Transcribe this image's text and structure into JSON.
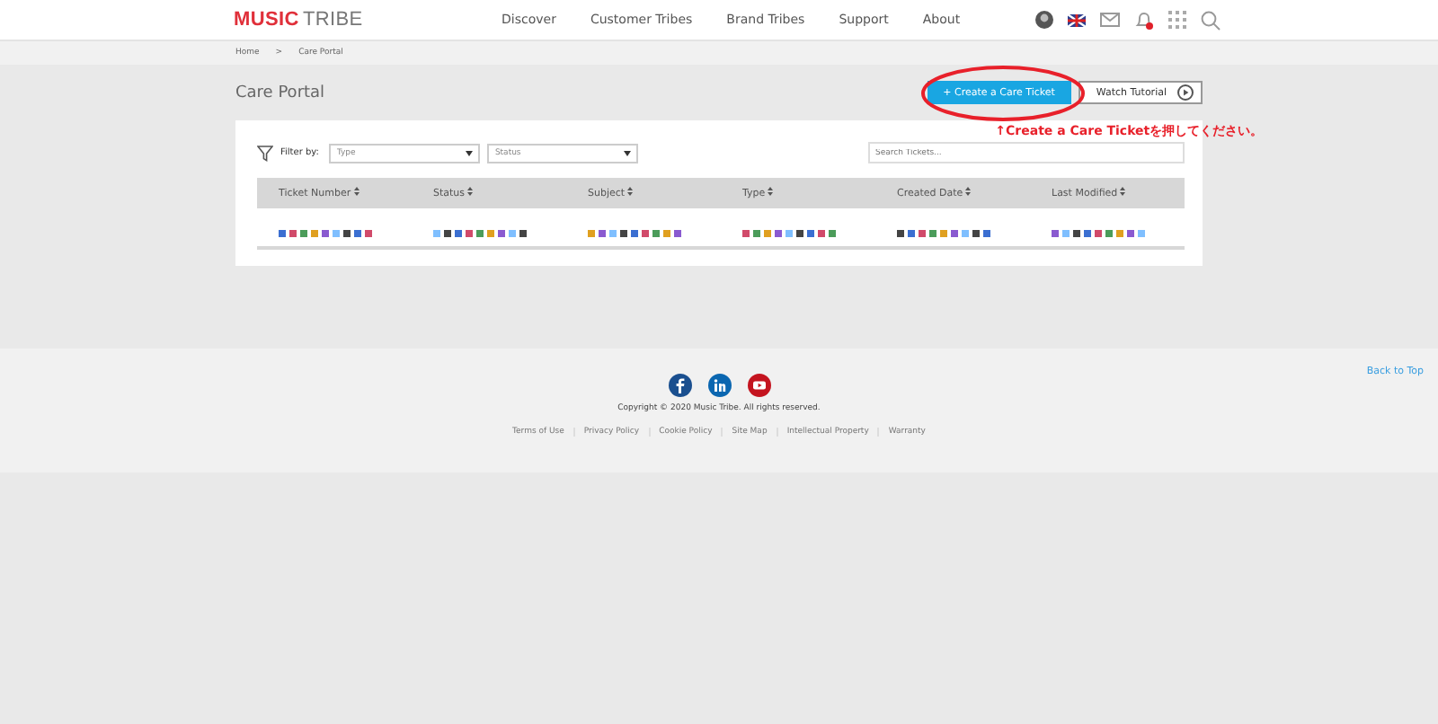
{
  "header": {
    "logo_bold": "MUSIC",
    "logo_light": "TRIBE",
    "nav": [
      {
        "label": "Discover"
      },
      {
        "label": "Customer Tribes"
      },
      {
        "label": "Brand Tribes"
      },
      {
        "label": "Support"
      },
      {
        "label": "About"
      }
    ],
    "notification_dot": true
  },
  "breadcrumb": [
    "Home",
    ">",
    "Care Portal"
  ],
  "page_title": "Care Portal",
  "actions": {
    "create": "+ Create a Care Ticket",
    "tutorial": "Watch Tutorial"
  },
  "annotation": {
    "text": "↑Create a Care Ticketを押してください。",
    "color": "#e8202a"
  },
  "filters": {
    "label": "Filter by:",
    "selects": [
      {
        "placeholder": "Type"
      },
      {
        "placeholder": "Status"
      }
    ],
    "search_placeholder": "Search Tickets..."
  },
  "table": {
    "columns": [
      "Ticket Number",
      "Status",
      "Subject",
      "Type",
      "Created Date",
      "Last Modified"
    ],
    "rows": [
      {
        "kind": "redacted"
      }
    ]
  },
  "footer": {
    "social": [
      {
        "kind": "facebook",
        "color": "#1a4f8f"
      },
      {
        "kind": "linkedin",
        "color": "#0a66b0"
      },
      {
        "kind": "youtube",
        "color": "#c4141f"
      }
    ],
    "copyright": "Copyright © 2020 Music Tribe. All rights reserved.",
    "links": [
      "Terms of Use",
      "Privacy Policy",
      "Cookie Policy",
      "Site Map",
      "Intellectual Property",
      "Warranty"
    ],
    "back_to_top": "Back to Top"
  }
}
